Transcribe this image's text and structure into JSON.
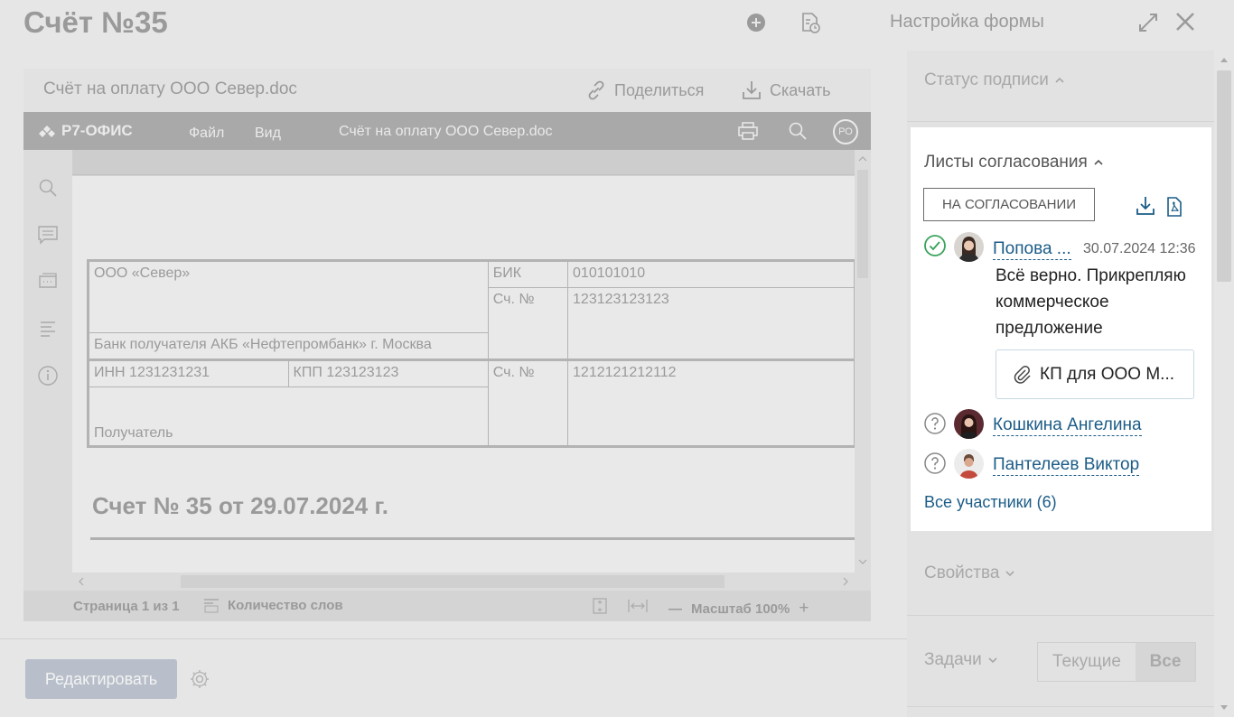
{
  "header": {
    "title": "Счёт №35",
    "form_settings": "Настройка формы"
  },
  "viewer": {
    "file_title": "Счёт на оплату ООО Север.doc",
    "share": "Поделиться",
    "download": "Скачать"
  },
  "editor": {
    "logo": "Р7-ОФИС",
    "menu_file": "Файл",
    "menu_view": "Вид",
    "doc_name": "Счёт на оплату ООО Север.doc",
    "user_initials": "РО"
  },
  "document": {
    "company": "ООО «Север»",
    "bik_label": "БИК",
    "bik_value": "010101010",
    "account_label": "Сч. №",
    "account_value": "123123123123",
    "bank": "Банк получателя АКБ «Нефтепромбанк» г. Москва",
    "inn": "ИНН 1231231231",
    "kpp": "КПП 123123123",
    "account2_label": "Сч. №",
    "account2_value": "1212121212112",
    "recipient": "Получатель",
    "invoice_title": "Счет № 35 от 29.07.2024 г."
  },
  "status_bar": {
    "page": "Страница 1 из 1",
    "words": "Количество слов",
    "zoom": "Масштаб 100%"
  },
  "footer": {
    "edit": "Редактировать"
  },
  "sidebar": {
    "sign_status": "Статус подписи",
    "approval": {
      "title": "Листы согласования",
      "status": "НА СОГЛАСОВАНИИ",
      "participants": [
        {
          "name": "Попова ...",
          "date": "30.07.2024 12:36",
          "comment": "Всё верно. Прикрепляю коммерческое предложение",
          "attachment": "КП для ООО М...",
          "status_icon": "check-circle-icon"
        },
        {
          "name": "Кошкина Ангелина",
          "status_icon": "question-circle-icon"
        },
        {
          "name": "Пантелеев Виктор",
          "status_icon": "question-circle-icon"
        }
      ],
      "all_participants": "Все участники (6)"
    },
    "properties": "Свойства",
    "tasks": "Задачи",
    "tasks_current": "Текущие",
    "tasks_all": "Все"
  },
  "colors": {
    "link": "#1b5c87",
    "success": "#3aa35a",
    "edit_button": "#b8bfca"
  }
}
